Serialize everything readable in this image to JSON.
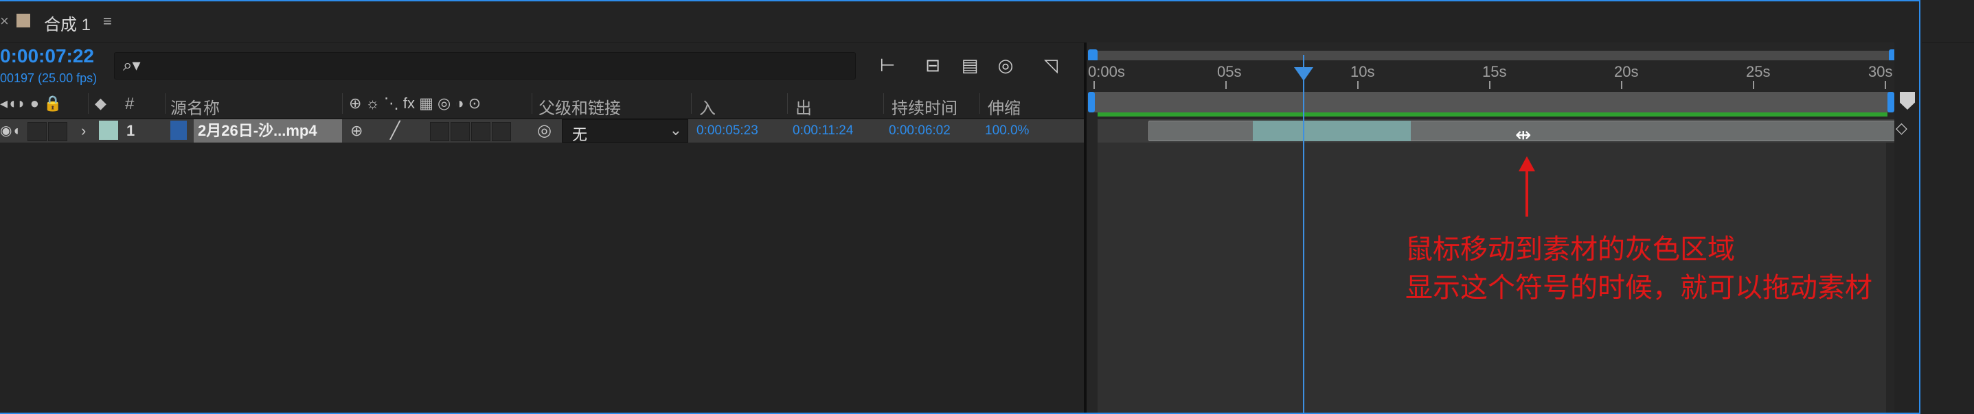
{
  "panel": {
    "tab_title": "合成 1",
    "tab_menu": "≡"
  },
  "time": {
    "timecode": "0:00:07:22",
    "frame_info": "00197 (25.00 fps)"
  },
  "search": {
    "placeholder": ""
  },
  "columns": {
    "num": "#",
    "source_name": "源名称",
    "parent": "父级和链接",
    "in": "入",
    "out": "出",
    "duration": "持续时间",
    "stretch": "伸缩"
  },
  "layer": {
    "index": "1",
    "name": "2月26日-沙...mp4",
    "parent_value": "无",
    "in": "0:00:05:23",
    "out": "0:00:11:24",
    "duration": "0:00:06:02",
    "stretch": "100.0%",
    "label_color": "#9ec9c0"
  },
  "ruler": {
    "labels": [
      "0:00s",
      "05s",
      "10s",
      "15s",
      "20s",
      "25s",
      "30s"
    ]
  },
  "annotation": {
    "line1": "鼠标移动到素材的灰色区域",
    "line2": "显示这个符号的时候，就可以拖动素材"
  },
  "colors": {
    "accent": "#2d8ceb",
    "annotation": "#e01818",
    "work_area_bar": "#2fa12f"
  }
}
